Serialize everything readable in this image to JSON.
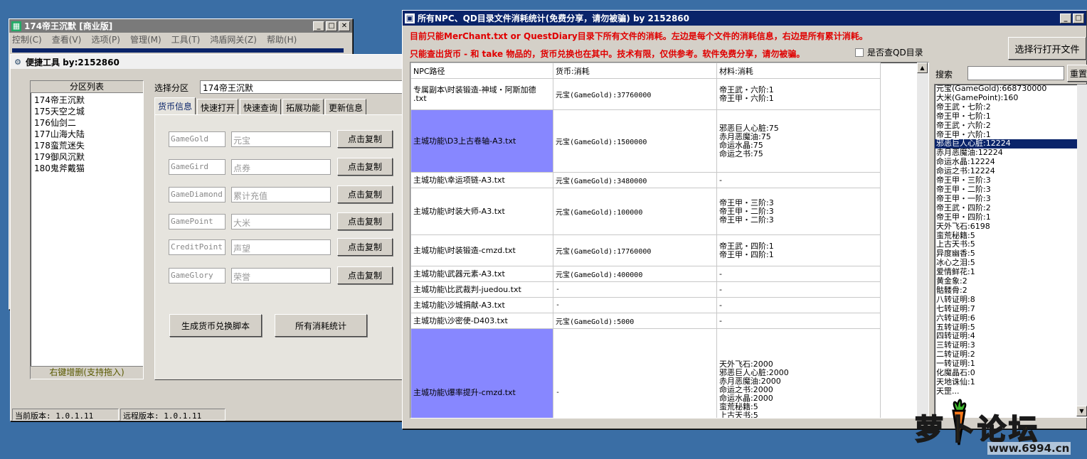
{
  "back_window": {
    "title": "174帝王沉默 [商业版]",
    "menu": [
      "控制(C)",
      "查看(V)",
      "选项(P)",
      "管理(M)",
      "工具(T)",
      "鸿盾网关(Z)",
      "帮助(H)"
    ]
  },
  "tool_window": {
    "title": "便捷工具   by:2152860",
    "zone_list_header": "分区列表",
    "zones": [
      "174帝王沉默",
      "175天空之城",
      "176仙剑二",
      "177山海大陆",
      "178蛮荒迷失",
      "179御风沉默",
      "180鬼斧戴猫"
    ],
    "zone_list_footer": "右键增删(支持拖入)",
    "select_zone_label": "选择分区",
    "select_zone_value": "174帝王沉默",
    "tabs": [
      "货币信息",
      "快速打开",
      "快速查询",
      "拓展功能",
      "更新信息"
    ],
    "currency_rows": [
      {
        "code": "GameGold",
        "name": "元宝",
        "button": "点击复制"
      },
      {
        "code": "GameGird",
        "name": "点券",
        "button": "点击复制"
      },
      {
        "code": "GameDiamond",
        "name": "累计充值",
        "button": "点击复制"
      },
      {
        "code": "GamePoint",
        "name": "大米",
        "button": "点击复制"
      },
      {
        "code": "CreditPoint",
        "name": "声望",
        "button": "点击复制"
      },
      {
        "code": "GameGlory",
        "name": "荣誉",
        "button": "点击复制"
      }
    ],
    "gen_script_button": "生成货币兑换脚本",
    "stats_button": "所有消耗统计",
    "status_current": "当前版本: 1.0.1.11",
    "status_remote": "远程版本: 1.0.1.11"
  },
  "stats_window": {
    "title": "所有NPC、QD目录文件消耗统计(免费分享，请勿被骗)     by 2152860",
    "notice_line1": "目前只能MerChant.txt or QuestDiary目录下所有文件的消耗。左边是每个文件的消耗信息，右边是所有累计消耗。",
    "notice_line2": "只能查出货币 - 和 take 物品的，货币兑换也在其中。技术有限，仅供参考。软件免费分享，请勿被骗。",
    "qd_checkbox_label": "是否查QD目录",
    "open_file_button": "选择行打开文件",
    "search_label": "搜索",
    "reset_button": "重置",
    "table_headers": [
      "NPC路径",
      "货币:消耗",
      "材料:消耗"
    ],
    "rows": [
      {
        "path": [
          "专属副本\\时装锻造-神域・阿斯加德",
          ".txt"
        ],
        "currency": "元宝(GameGold):37760000",
        "materials": [
          "帝王武・六阶:1",
          "帝王甲・六阶:1"
        ],
        "highlight": false
      },
      {
        "path": [
          "主城功能\\D3上古卷轴-A3.txt"
        ],
        "currency": "元宝(GameGold):1500000",
        "materials": [
          "邪恶巨人心脏:75",
          "赤月恶魔油:75",
          "命运水晶:75",
          "命运之书:75"
        ],
        "highlight": true
      },
      {
        "path": [
          "主城功能\\幸运项链-A3.txt"
        ],
        "currency": "元宝(GameGold):3480000",
        "materials": [
          "-"
        ],
        "highlight": false
      },
      {
        "path": [
          "主城功能\\时装大师-A3.txt"
        ],
        "currency": "元宝(GameGold):100000",
        "materials": [
          "帝王甲・三阶:3",
          "帝王甲・二阶:3",
          "帝王甲・二阶:3"
        ],
        "highlight": false
      },
      {
        "path": [
          "主城功能\\时装锻造-cmzd.txt"
        ],
        "currency": "元宝(GameGold):17760000",
        "materials": [
          "帝王武・四阶:1",
          "帝王甲・四阶:1"
        ],
        "highlight": false
      },
      {
        "path": [
          "主城功能\\武器元素-A3.txt"
        ],
        "currency": "元宝(GameGold):400000",
        "materials": [
          "-"
        ],
        "highlight": false
      },
      {
        "path": [
          "主城功能\\比武裁判-juedou.txt"
        ],
        "currency": "-",
        "materials": [
          "-"
        ],
        "highlight": false
      },
      {
        "path": [
          "主城功能\\沙城捐献-A3.txt"
        ],
        "currency": "-",
        "materials": [
          "-"
        ],
        "highlight": false
      },
      {
        "path": [
          "主城功能\\沙密使-D403.txt"
        ],
        "currency": "元宝(GameGold):5000",
        "materials": [
          "-"
        ],
        "highlight": false
      },
      {
        "path": [
          "主城功能\\爆率提升-cmzd.txt"
        ],
        "currency": "-",
        "materials": [
          "天外飞石:2000",
          "邪恶巨人心脏:2000",
          "赤月恶魔油:2000",
          "命运之书:2000",
          "命运水晶:2000",
          "蛮荒秘籍:5",
          "上古天书:5"
        ],
        "highlight": true
      }
    ],
    "totals": [
      "元宝(GameGold):668730000",
      "大米(GamePoint):160",
      "帝王武・七阶:2",
      "帝王甲・七阶:1",
      "帝王武・六阶:2",
      "帝王甲・六阶:1",
      "邪恶巨人心脏:12224",
      "赤月恶魔油:12224",
      "命运水晶:12224",
      "命运之书:12224",
      "帝王甲・三阶:3",
      "帝王甲・二阶:3",
      "帝王甲・一阶:3",
      "帝王武・四阶:2",
      "帝王甲・四阶:1",
      "天外飞石:6198",
      "蛮荒秘籍:5",
      "上古天书:5",
      "异度幽香:5",
      "冰心之泪:5",
      "爱情鲜花:1",
      "黄金象:2",
      "骷髅骨:2",
      "八转证明:8",
      "七转证明:7",
      "六转证明:6",
      "五转证明:5",
      "四转证明:4",
      "三转证明:3",
      "二转证明:2",
      "一转证明:1",
      "化魔晶石:0",
      "天地诛仙:1",
      "天罡..."
    ],
    "totals_selected_index": 6
  },
  "watermark": {
    "logo_text": "萝卜论坛",
    "url": "www.6994.cn"
  },
  "colors": {
    "title_active": "#0a246a",
    "highlight_row": "#8787ff",
    "notice_red": "#e00000",
    "desktop": "#3a6ea5"
  }
}
